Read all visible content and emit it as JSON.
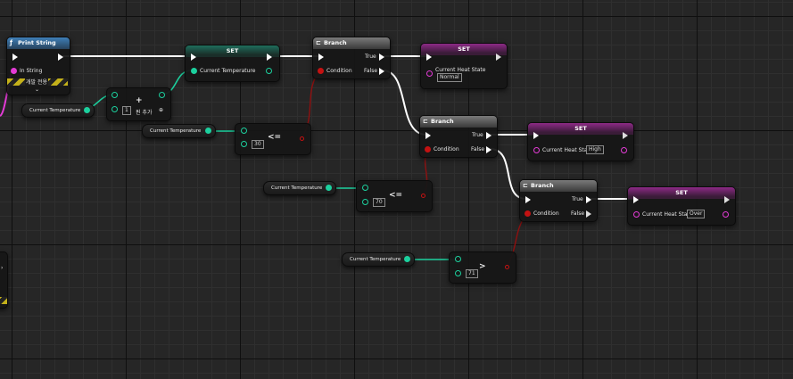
{
  "colors": {
    "exec_wire": "#ffffff",
    "float_wire": "#1cd09e",
    "bool_wire": "#8e1010",
    "enum_pin": "#e43bd6",
    "set_header_float": "#1f6e5c",
    "set_header_enum": "#8d2a86",
    "branch_header": "#7a7a7a",
    "function_header": "#3f7fb8"
  },
  "print_string": {
    "title": "Print String",
    "in_string": "In String",
    "dev_only": "개발 전용",
    "icon": "function-icon"
  },
  "add_node": {
    "value": "1",
    "add_pin": "핀 추가",
    "plus": "+"
  },
  "set_temp": {
    "title": "SET",
    "pin_label": "Current Temperature"
  },
  "getters": {
    "g1": "Current Temperature",
    "g2": "Current Temperature",
    "g3": "Current Temperature",
    "g4": "Current Temperature"
  },
  "compare1": {
    "op": "<=",
    "value": "30"
  },
  "compare2": {
    "op": "<=",
    "value": "70"
  },
  "compare3": {
    "op": ">",
    "value": "71"
  },
  "branch1": {
    "title": "Branch",
    "condition": "Condition",
    "true": "True",
    "false": "False"
  },
  "branch2": {
    "title": "Branch",
    "condition": "Condition",
    "true": "True",
    "false": "False"
  },
  "branch3": {
    "title": "Branch",
    "condition": "Condition",
    "true": "True",
    "false": "False"
  },
  "set_heat1": {
    "title": "SET",
    "pin_label": "Current Heat State",
    "value": "Normal"
  },
  "set_heat2": {
    "title": "SET",
    "pin_label": "Current Heat State",
    "value": "High"
  },
  "set_heat3": {
    "title": "SET",
    "pin_label": "Current Heat State",
    "value": "Over"
  }
}
